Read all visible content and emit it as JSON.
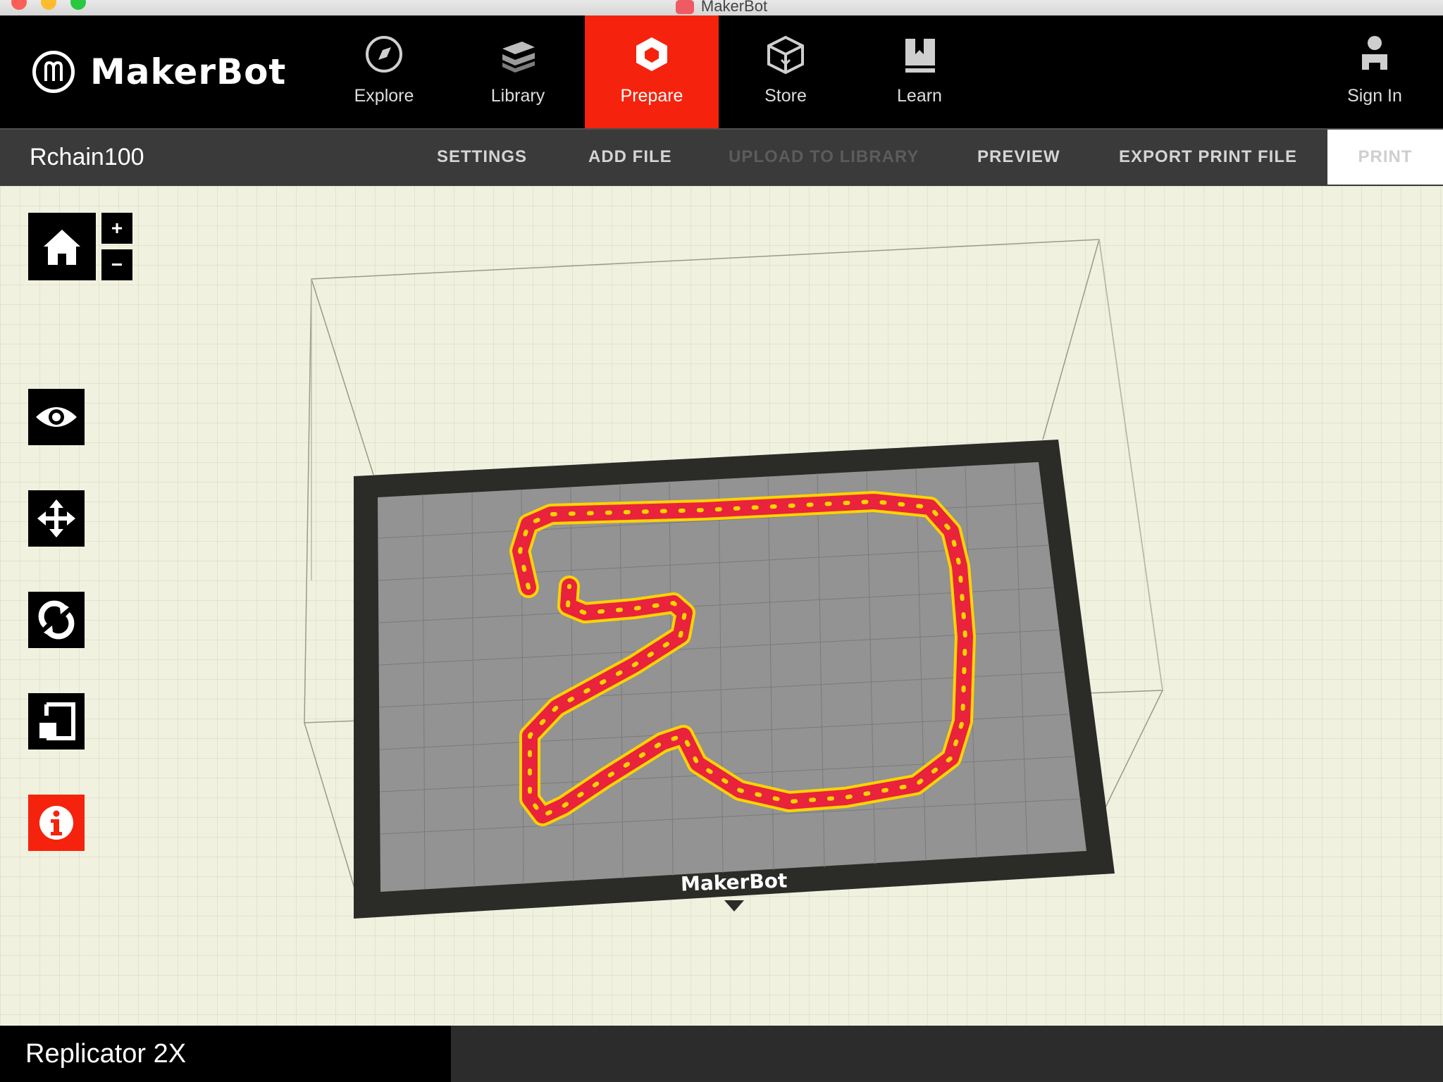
{
  "window": {
    "title": "MakerBot"
  },
  "brand": {
    "name": "MakerBot"
  },
  "nav": {
    "items": [
      {
        "label": "Explore",
        "icon": "compass-icon"
      },
      {
        "label": "Library",
        "icon": "library-icon"
      },
      {
        "label": "Prepare",
        "icon": "prepare-icon",
        "active": true
      },
      {
        "label": "Store",
        "icon": "store-box-icon"
      },
      {
        "label": "Learn",
        "icon": "book-icon"
      }
    ],
    "sign_in": {
      "label": "Sign In",
      "icon": "user-icon"
    }
  },
  "toolbar": {
    "project_name": "Rchain100",
    "settings": "SETTINGS",
    "add_file": "ADD FILE",
    "upload": "UPLOAD TO LIBRARY",
    "preview": "PREVIEW",
    "export": "EXPORT PRINT FILE",
    "print": "PRINT"
  },
  "viewport": {
    "build_plate_brand": "MakerBot",
    "zoom_in": "+",
    "zoom_out": "−",
    "tools": [
      "home-icon",
      "eye-icon",
      "move-icon",
      "rotate-icon",
      "scale-icon",
      "info-icon"
    ]
  },
  "status": {
    "printer": "Replicator 2X"
  },
  "colors": {
    "accent": "#f5230d",
    "model": "#e8233b",
    "model_outline": "#ffd400"
  }
}
